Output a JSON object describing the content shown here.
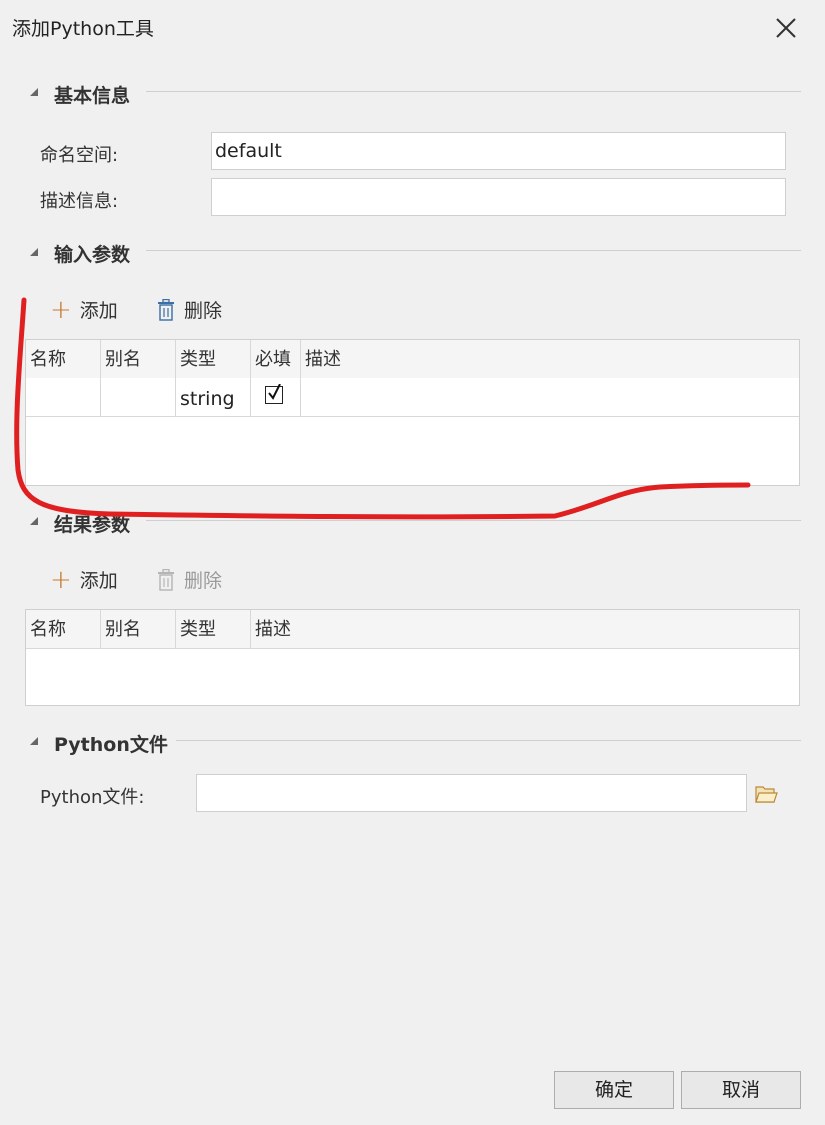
{
  "dialog": {
    "title": "添加Python工具",
    "close_icon": "close-x-icon"
  },
  "basic_info": {
    "section_title": "基本信息",
    "namespace_label": "命名空间:",
    "namespace_value": "default",
    "description_label": "描述信息:",
    "description_value": ""
  },
  "input_params": {
    "section_title": "输入参数",
    "add_label": "添加",
    "delete_label": "删除",
    "columns": [
      "名称",
      "别名",
      "类型",
      "必填",
      "描述"
    ],
    "rows": [
      {
        "name": "",
        "alias": "",
        "type": "string",
        "required": true,
        "description": ""
      }
    ]
  },
  "result_params": {
    "section_title": "结果参数",
    "add_label": "添加",
    "delete_label": "删除",
    "delete_disabled": true,
    "columns": [
      "名称",
      "别名",
      "类型",
      "描述"
    ],
    "rows": []
  },
  "python_file": {
    "section_title": "Python文件",
    "field_label": "Python文件:",
    "field_value": "",
    "browse_icon": "folder-open-icon"
  },
  "footer": {
    "ok_label": "确定",
    "cancel_label": "取消"
  },
  "colors": {
    "background": "#f0f0f0",
    "annotation_stroke": "#e02020",
    "accent_plus": "#c47a2c",
    "trash_icon": "#3a6ea5"
  }
}
